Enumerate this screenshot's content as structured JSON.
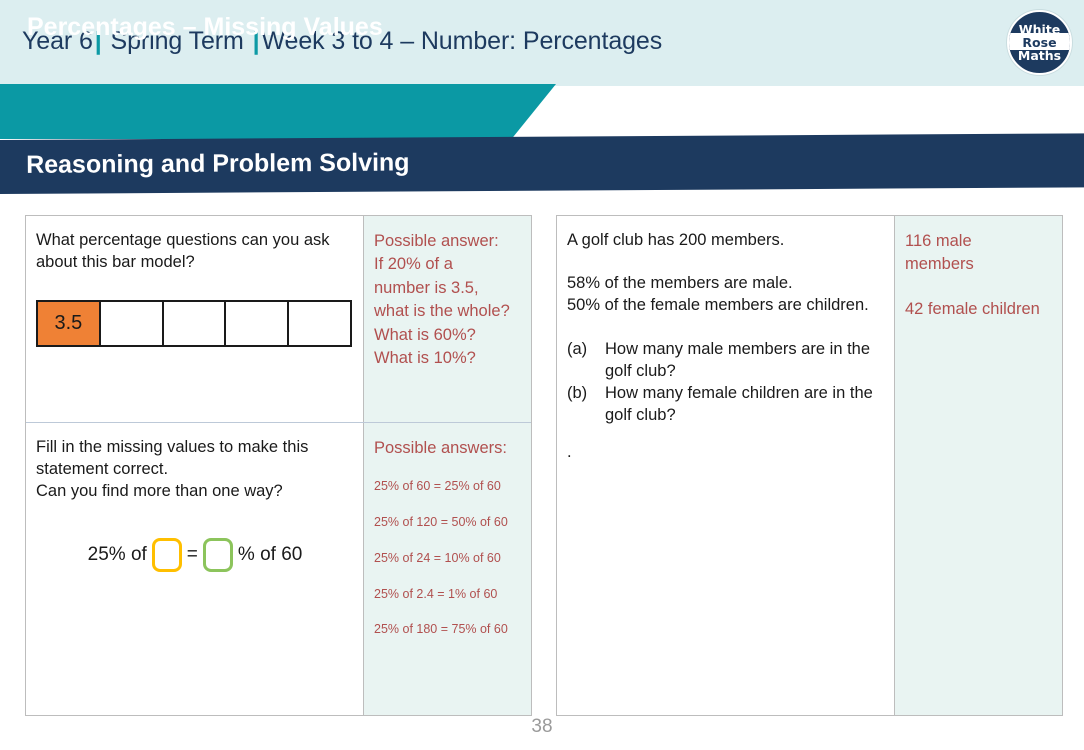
{
  "header": {
    "year": "Year 6",
    "term": "Spring Term",
    "week_topic": "Week 3 to 4 – Number: Percentages",
    "separator": "|"
  },
  "logo": {
    "line1": "White",
    "line2": "Rose",
    "line3": "Maths",
    "alt": "White Rose Maths"
  },
  "banners": {
    "lesson_title": "Percentages – Missing Values",
    "section_title": "Reasoning and Problem Solving"
  },
  "colors": {
    "header_bg": "#dceef0",
    "teal": "#0b99a4",
    "navy": "#1d3a5f",
    "answer_bg": "#e9f4f2",
    "answer_text": "#b1504f",
    "orange_bar": "#ef8135",
    "yellow_box": "#ffbf00",
    "green_box": "#8cc45c",
    "table_border": "#bdbdbd",
    "page_number": "#9a9a9a"
  },
  "left_table": {
    "row1": {
      "question_line1": "What percentage questions can you ask",
      "question_line2": "about this bar model?",
      "bar_model": {
        "cells": [
          "3.5",
          "",
          "",
          "",
          ""
        ],
        "filled_index": 0
      },
      "answer_heading": "Possible answer:",
      "answer_lines": [
        "If 20% of a",
        "number is 3.5,",
        "what is the whole?",
        "What is 60%?",
        "What is 10%?"
      ]
    },
    "row2": {
      "question_line1": "Fill in the missing values to make this",
      "question_line2": "statement correct.",
      "question_line3": "Can you find more than one way?",
      "equation": {
        "prefix": "25% of",
        "box1_value": "",
        "equals": "=",
        "box2_value": "",
        "suffix": "% of 60"
      },
      "answer_heading": "Possible answers:",
      "answer_lines": [
        "25% of 60 = 25% of 60",
        "25% of 120 = 50% of 60",
        "25% of 24 = 10% of 60",
        "25% of 2.4 = 1% of 60",
        "25% of 180 =  75% of 60"
      ]
    }
  },
  "right_table": {
    "row1": {
      "question_lines": [
        "A golf club has 200 members.",
        "",
        "58% of the members are male.",
        "50% of the female members are children."
      ],
      "sub_questions": [
        {
          "label": "(a)",
          "text": "How many male members are in the golf club?"
        },
        {
          "label": "(b)",
          "text": "How many female children are in the golf club?"
        }
      ],
      "trailing_mark": ".",
      "answer_lines": [
        "116 male",
        "members",
        "",
        "42 female children"
      ]
    }
  },
  "footer": {
    "page_number": "38"
  }
}
